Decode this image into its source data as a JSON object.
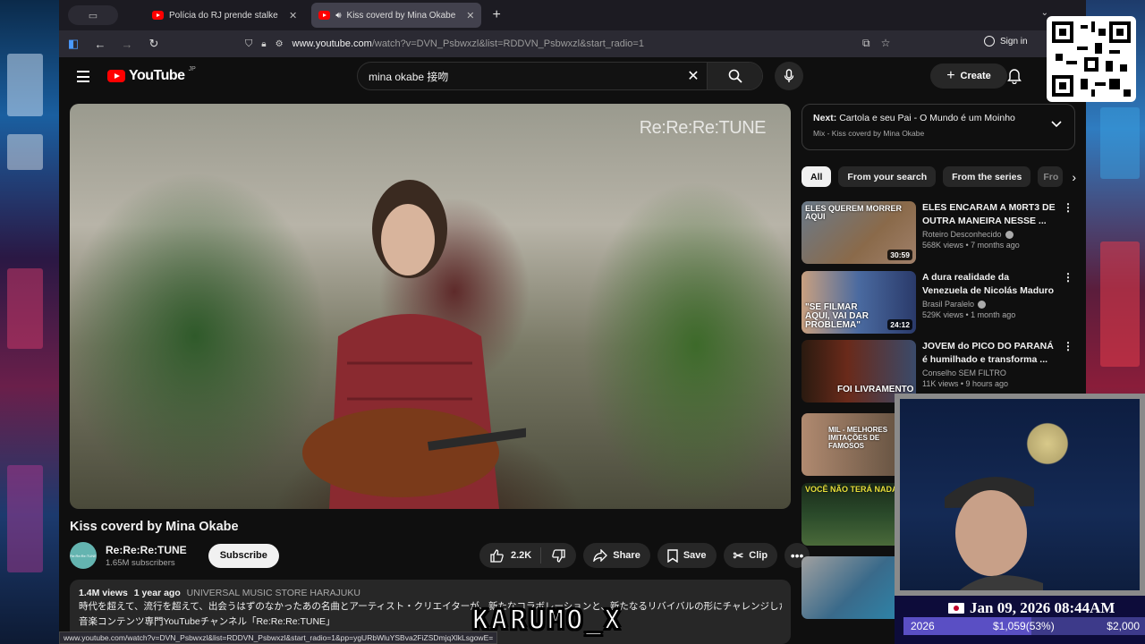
{
  "browser": {
    "tabs": [
      {
        "title": "Polícia do RJ prende stalker da",
        "active": false
      },
      {
        "title": "Kiss coverd by Mina Okabe",
        "active": true
      }
    ],
    "url_host": "www.youtube.com",
    "url_path": "/watch?v=DVN_Psbwxzl&list=RDDVN_Psbwxzl&start_radio=1",
    "sign_in": "Sign in",
    "status_url": "www.youtube.com/watch?v=DVN_Psbwxzl&list=RDDVN_Psbwxzl&start_radio=1&pp=ygURbWluYSBva2FiZSDmjqXlkLsgowE="
  },
  "youtube": {
    "logo_text": "YouTube",
    "logo_region": "JP",
    "search_query": "mina okabe 接吻",
    "create_label": "Create"
  },
  "video": {
    "watermark": "Re:Re:Re:TUNE",
    "title": "Kiss coverd by Mina Okabe",
    "channel": "Re:Re:Re:TUNE",
    "avatar_text": "Re:Re:Re:TUNE",
    "subscribers": "1.65M subscribers",
    "subscribe_label": "Subscribe",
    "likes": "2.2K",
    "share_label": "Share",
    "save_label": "Save",
    "clip_label": "Clip",
    "views": "1.4M views",
    "age": "1 year ago",
    "label": "UNIVERSAL MUSIC STORE HARAJUKU",
    "desc_line1": "時代を超えて、流行を超えて、出会うはずのなかったあの名曲とアーティスト・クリエイターが、新たなコラボレーションと、新たなるリバイバルの形にチャレンジした",
    "desc_line2": "音楽コンテンツ専門YouTubeチャンネル「Re:Re:Re:TUNE」"
  },
  "up_next": {
    "prefix": "Next:",
    "title": "Cartola e seu Pai - O Mundo é um Moinho",
    "mix": "Mix - Kiss coverd by Mina Okabe"
  },
  "chips": [
    "All",
    "From your search",
    "From the series",
    "Fro"
  ],
  "recommendations": [
    {
      "title": "ELES ENCARAM A M0RT3 DE OUTRA MANEIRA NESSE ...",
      "channel": "Roteiro Desconhecido",
      "verified": true,
      "meta": "568K views • 7 months ago",
      "duration": "30:59",
      "caption": "ELES QUEREM MORRER AQUI",
      "color": "#8a6a4a"
    },
    {
      "title": "A dura realidade da Venezuela de Nicolás Maduro",
      "channel": "Brasil Paralelo",
      "verified": true,
      "meta": "529K views • 1 month ago",
      "duration": "24:12",
      "caption": "\"SE FILMAR AQUI, VAI DAR PROBLEMA\"",
      "color": "#2a3a6a"
    },
    {
      "title": "JOVEM do PICO DO PARANÁ é humilhado e transforma ...",
      "channel": "Conselho SEM FILTRO",
      "verified": false,
      "meta": "11K views • 9 hours ago",
      "duration": "",
      "caption": "FOI LIVRAMENTO",
      "color": "#6a2a1a"
    }
  ],
  "extra_thumbs": [
    {
      "caption": "MIL - MELHORES IMITAÇÕES DE FAMOSOS",
      "color": "#5a4a3a"
    },
    {
      "caption": "VOCÊ NÃO TERÁ NADA",
      "color": "#2a4a2a"
    },
    {
      "caption": "",
      "color": "#3a6a8a"
    }
  ],
  "overlay": {
    "datetime": "Jan 09, 2026 08:44AM",
    "year": "2026",
    "progress_text": "$1,059(53%)",
    "goal": "$2,000",
    "progress": 0.53,
    "streamer_name": "KARUMO_X"
  }
}
